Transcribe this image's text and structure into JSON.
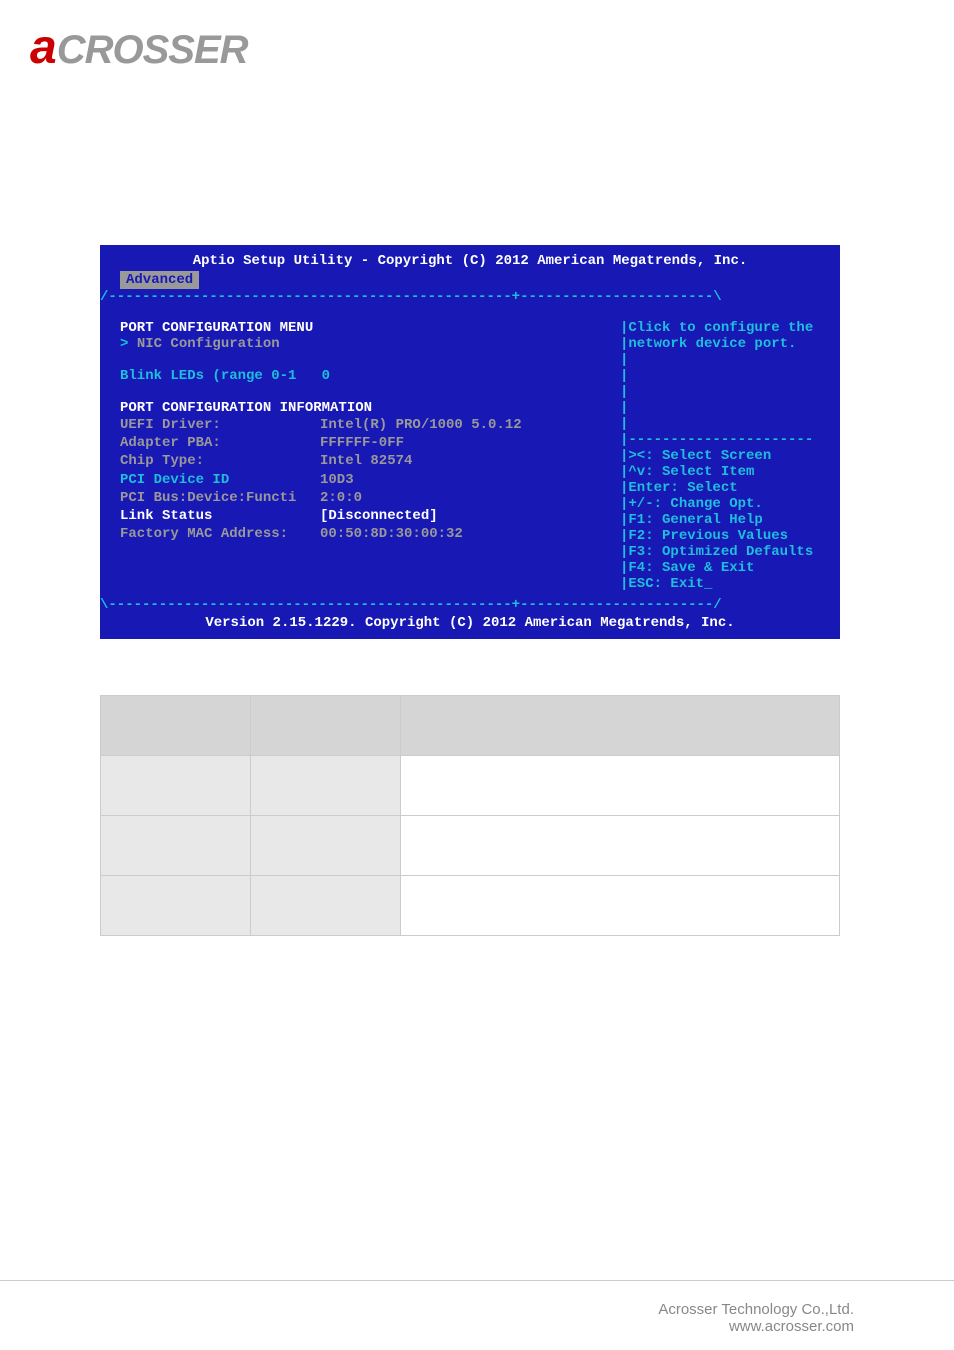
{
  "logo": {
    "red_part": "a",
    "gray_part": "CROSSER"
  },
  "bios": {
    "title": "Aptio Setup Utility - Copyright (C) 2012 American Megatrends, Inc.",
    "tab": "Advanced",
    "help_text_1": "Click to configure the",
    "help_text_2": "network device port.",
    "section_header": "PORT CONFIGURATION MENU",
    "nic_config": "NIC Configuration",
    "blink_label": "Blink LEDs (range 0-1",
    "blink_value": "0",
    "info_header": "PORT CONFIGURATION INFORMATION",
    "rows": [
      {
        "label": "UEFI Driver:",
        "value": "Intel(R) PRO/1000 5.0.12",
        "labelColor": "gray",
        "valueColor": "gray"
      },
      {
        "label": "Adapter PBA:",
        "value": "FFFFFF-0FF",
        "labelColor": "gray",
        "valueColor": "gray"
      },
      {
        "label": "Chip Type:",
        "value": "Intel 82574",
        "labelColor": "gray",
        "valueColor": "gray"
      },
      {
        "label": "PCI Device ID",
        "value": "10D3",
        "labelColor": "teal",
        "valueColor": "gray"
      },
      {
        "label": "PCI Bus:Device:Functi",
        "value": "2:0:0",
        "labelColor": "gray",
        "valueColor": "gray"
      },
      {
        "label": "Link Status",
        "value": "[Disconnected]",
        "labelColor": "white",
        "valueColor": "white"
      },
      {
        "label": "Factory MAC Address:",
        "value": "00:50:8D:30:00:32",
        "labelColor": "gray",
        "valueColor": "gray"
      }
    ],
    "nav_hints": [
      "><: Select Screen",
      "^v: Select Item",
      "Enter: Select",
      "+/-: Change Opt.",
      "F1: General Help",
      "F2: Previous Values",
      "F3: Optimized Defaults",
      "F4: Save & Exit",
      "ESC: Exit_"
    ],
    "footer": "Version 2.15.1229. Copyright (C) 2012 American Megatrends, Inc."
  },
  "footer": {
    "company": "Acrosser Technology Co.,Ltd.",
    "url": "www.acrosser.com"
  }
}
